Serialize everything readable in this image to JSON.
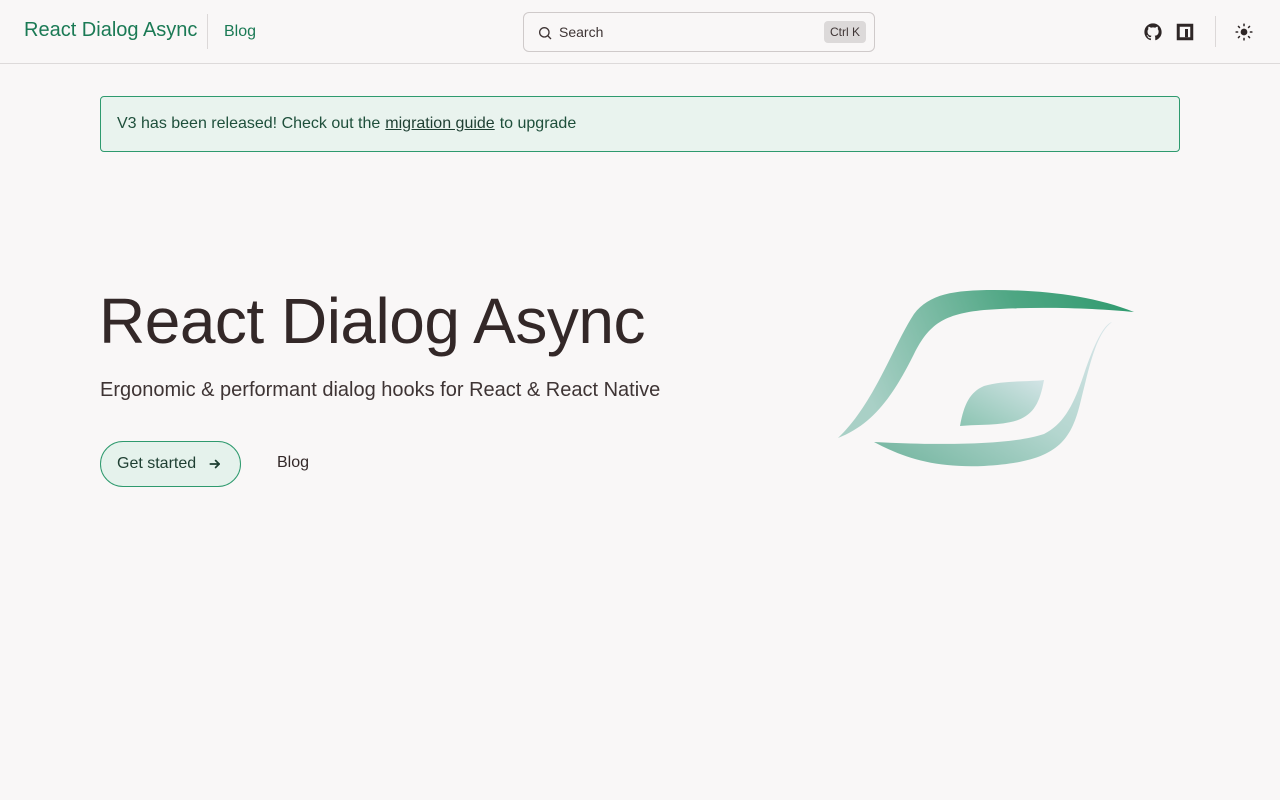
{
  "navbar": {
    "brand": "React Dialog Async",
    "blog_link": "Blog",
    "search": {
      "placeholder": "Search",
      "shortcut": "Ctrl K"
    },
    "icons": [
      "github-icon",
      "npm-icon",
      "theme-toggle-sun-icon"
    ]
  },
  "banner": {
    "text_before": "V3 has been released! Check out the",
    "link": "migration guide",
    "text_after": "to upgrade"
  },
  "hero": {
    "title": "React Dialog Async",
    "subtitle": "Ergonomic & performant dialog hooks for React & React Native",
    "primary_button": "Get started",
    "secondary_button": "Blog"
  },
  "colors": {
    "accent": "#1b7a55",
    "border_accent": "#2e9a6e",
    "background": "#f9f7f7"
  }
}
